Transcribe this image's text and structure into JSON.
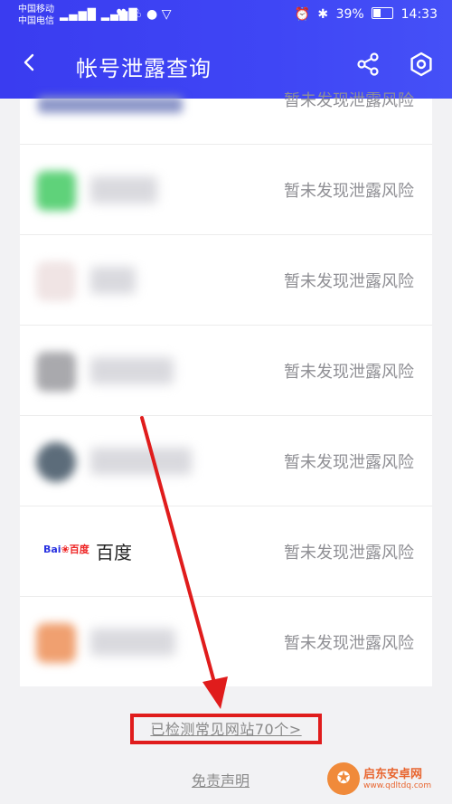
{
  "status_bar": {
    "carrier_1": "中国移动",
    "carrier_2": "中国电信",
    "signal": "²⁶ᵢₗₗ ³⁶ᵢₗₗ",
    "battery": "39%",
    "time": "14:33"
  },
  "header": {
    "title": "帐号泄露查询"
  },
  "rows": [
    {
      "status": "暂未发现泄露风险"
    },
    {
      "status": "暂未发现泄露风险"
    },
    {
      "status": "暂未发现泄露风险"
    },
    {
      "status": "暂未发现泄露风险"
    },
    {
      "status": "暂未发现泄露风险"
    },
    {
      "name": "百度",
      "logo_text_1": "Bai",
      "logo_text_2": "百度",
      "status": "暂未发现泄露风险"
    },
    {
      "status": "暂未发现泄露风险"
    }
  ],
  "footer": {
    "checked_link": "已检测常见网站70个>",
    "disclaimer": "免责声明"
  },
  "watermark": {
    "brand": "启东安卓网",
    "url": "www.qdltdq.com"
  },
  "colors": {
    "header_bg": "#3f46f5",
    "status_text": "#8f8f94",
    "highlight": "#e01c1c"
  }
}
